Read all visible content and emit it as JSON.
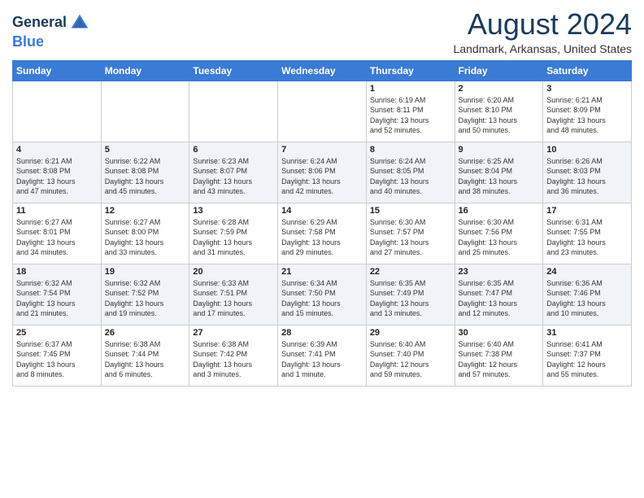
{
  "header": {
    "logo_line1": "General",
    "logo_line2": "Blue",
    "month_year": "August 2024",
    "location": "Landmark, Arkansas, United States"
  },
  "calendar": {
    "days_of_week": [
      "Sunday",
      "Monday",
      "Tuesday",
      "Wednesday",
      "Thursday",
      "Friday",
      "Saturday"
    ],
    "weeks": [
      [
        {
          "day": "",
          "info": ""
        },
        {
          "day": "",
          "info": ""
        },
        {
          "day": "",
          "info": ""
        },
        {
          "day": "",
          "info": ""
        },
        {
          "day": "1",
          "info": "Sunrise: 6:19 AM\nSunset: 8:11 PM\nDaylight: 13 hours\nand 52 minutes."
        },
        {
          "day": "2",
          "info": "Sunrise: 6:20 AM\nSunset: 8:10 PM\nDaylight: 13 hours\nand 50 minutes."
        },
        {
          "day": "3",
          "info": "Sunrise: 6:21 AM\nSunset: 8:09 PM\nDaylight: 13 hours\nand 48 minutes."
        }
      ],
      [
        {
          "day": "4",
          "info": "Sunrise: 6:21 AM\nSunset: 8:08 PM\nDaylight: 13 hours\nand 47 minutes."
        },
        {
          "day": "5",
          "info": "Sunrise: 6:22 AM\nSunset: 8:08 PM\nDaylight: 13 hours\nand 45 minutes."
        },
        {
          "day": "6",
          "info": "Sunrise: 6:23 AM\nSunset: 8:07 PM\nDaylight: 13 hours\nand 43 minutes."
        },
        {
          "day": "7",
          "info": "Sunrise: 6:24 AM\nSunset: 8:06 PM\nDaylight: 13 hours\nand 42 minutes."
        },
        {
          "day": "8",
          "info": "Sunrise: 6:24 AM\nSunset: 8:05 PM\nDaylight: 13 hours\nand 40 minutes."
        },
        {
          "day": "9",
          "info": "Sunrise: 6:25 AM\nSunset: 8:04 PM\nDaylight: 13 hours\nand 38 minutes."
        },
        {
          "day": "10",
          "info": "Sunrise: 6:26 AM\nSunset: 8:03 PM\nDaylight: 13 hours\nand 36 minutes."
        }
      ],
      [
        {
          "day": "11",
          "info": "Sunrise: 6:27 AM\nSunset: 8:01 PM\nDaylight: 13 hours\nand 34 minutes."
        },
        {
          "day": "12",
          "info": "Sunrise: 6:27 AM\nSunset: 8:00 PM\nDaylight: 13 hours\nand 33 minutes."
        },
        {
          "day": "13",
          "info": "Sunrise: 6:28 AM\nSunset: 7:59 PM\nDaylight: 13 hours\nand 31 minutes."
        },
        {
          "day": "14",
          "info": "Sunrise: 6:29 AM\nSunset: 7:58 PM\nDaylight: 13 hours\nand 29 minutes."
        },
        {
          "day": "15",
          "info": "Sunrise: 6:30 AM\nSunset: 7:57 PM\nDaylight: 13 hours\nand 27 minutes."
        },
        {
          "day": "16",
          "info": "Sunrise: 6:30 AM\nSunset: 7:56 PM\nDaylight: 13 hours\nand 25 minutes."
        },
        {
          "day": "17",
          "info": "Sunrise: 6:31 AM\nSunset: 7:55 PM\nDaylight: 13 hours\nand 23 minutes."
        }
      ],
      [
        {
          "day": "18",
          "info": "Sunrise: 6:32 AM\nSunset: 7:54 PM\nDaylight: 13 hours\nand 21 minutes."
        },
        {
          "day": "19",
          "info": "Sunrise: 6:32 AM\nSunset: 7:52 PM\nDaylight: 13 hours\nand 19 minutes."
        },
        {
          "day": "20",
          "info": "Sunrise: 6:33 AM\nSunset: 7:51 PM\nDaylight: 13 hours\nand 17 minutes."
        },
        {
          "day": "21",
          "info": "Sunrise: 6:34 AM\nSunset: 7:50 PM\nDaylight: 13 hours\nand 15 minutes."
        },
        {
          "day": "22",
          "info": "Sunrise: 6:35 AM\nSunset: 7:49 PM\nDaylight: 13 hours\nand 13 minutes."
        },
        {
          "day": "23",
          "info": "Sunrise: 6:35 AM\nSunset: 7:47 PM\nDaylight: 13 hours\nand 12 minutes."
        },
        {
          "day": "24",
          "info": "Sunrise: 6:36 AM\nSunset: 7:46 PM\nDaylight: 13 hours\nand 10 minutes."
        }
      ],
      [
        {
          "day": "25",
          "info": "Sunrise: 6:37 AM\nSunset: 7:45 PM\nDaylight: 13 hours\nand 8 minutes."
        },
        {
          "day": "26",
          "info": "Sunrise: 6:38 AM\nSunset: 7:44 PM\nDaylight: 13 hours\nand 6 minutes."
        },
        {
          "day": "27",
          "info": "Sunrise: 6:38 AM\nSunset: 7:42 PM\nDaylight: 13 hours\nand 3 minutes."
        },
        {
          "day": "28",
          "info": "Sunrise: 6:39 AM\nSunset: 7:41 PM\nDaylight: 13 hours\nand 1 minute."
        },
        {
          "day": "29",
          "info": "Sunrise: 6:40 AM\nSunset: 7:40 PM\nDaylight: 12 hours\nand 59 minutes."
        },
        {
          "day": "30",
          "info": "Sunrise: 6:40 AM\nSunset: 7:38 PM\nDaylight: 12 hours\nand 57 minutes."
        },
        {
          "day": "31",
          "info": "Sunrise: 6:41 AM\nSunset: 7:37 PM\nDaylight: 12 hours\nand 55 minutes."
        }
      ]
    ]
  }
}
